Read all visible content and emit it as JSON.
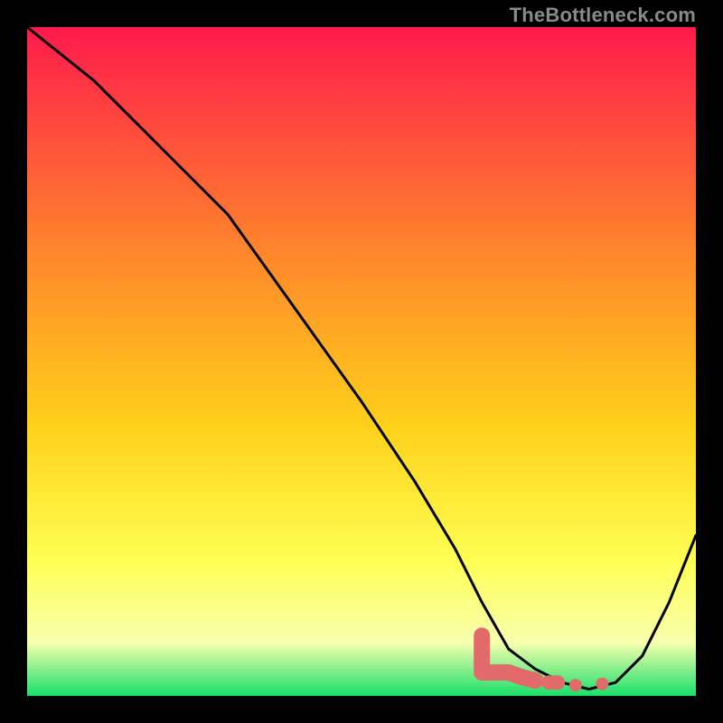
{
  "watermark": "TheBottleneck.com",
  "colors": {
    "gradient_top": "#ff1a4b",
    "gradient_mid1": "#ff8a2a",
    "gradient_mid2": "#ffd21a",
    "gradient_mid3": "#ffff55",
    "gradient_mid4": "#f8ffae",
    "gradient_bottom": "#18e06a",
    "curve": "#000000",
    "marker": "#e26a6a"
  },
  "chart_data": {
    "type": "line",
    "title": "",
    "xlabel": "",
    "ylabel": "",
    "xlim": [
      0,
      100
    ],
    "ylim": [
      0,
      100
    ],
    "series": [
      {
        "name": "bottleneck-curve",
        "x": [
          0,
          10,
          22,
          30,
          40,
          50,
          58,
          64,
          68,
          72,
          76,
          80,
          84,
          88,
          92,
          96,
          100
        ],
        "y": [
          100,
          92,
          80,
          72,
          58,
          44,
          32,
          22,
          14,
          7,
          4,
          2,
          1,
          2,
          6,
          14,
          24
        ]
      }
    ],
    "markers": {
      "name": "highlight-region",
      "x": [
        68,
        70,
        72,
        74,
        76,
        78,
        82,
        86
      ],
      "y": [
        6,
        4.5,
        3.5,
        2.8,
        2.3,
        2.0,
        1.6,
        1.8
      ]
    }
  }
}
